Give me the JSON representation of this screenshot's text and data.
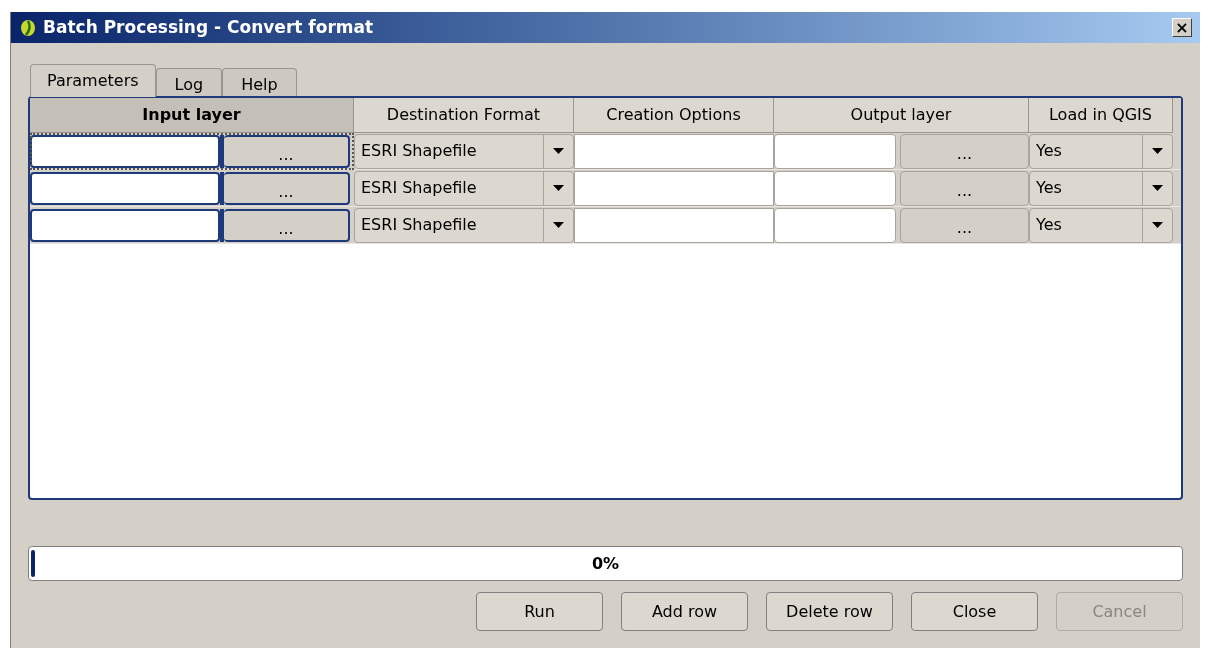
{
  "window": {
    "title": "Batch Processing - Convert format",
    "close_glyph": "×"
  },
  "tabs": [
    {
      "label": "Parameters",
      "selected": true
    },
    {
      "label": "Log",
      "selected": false
    },
    {
      "label": "Help",
      "selected": false
    }
  ],
  "table": {
    "columns": [
      "Input layer",
      "Destination Format",
      "Creation Options",
      "Output layer",
      "Load in QGIS"
    ],
    "rows": [
      {
        "current": true,
        "input_button": "...",
        "destination_format": "ESRI Shapefile",
        "output_button": "...",
        "load_in_qgis": "Yes"
      },
      {
        "current": false,
        "input_button": "...",
        "destination_format": "ESRI Shapefile",
        "output_button": "...",
        "load_in_qgis": "Yes"
      },
      {
        "current": false,
        "input_button": "...",
        "destination_format": "ESRI Shapefile",
        "output_button": "...",
        "load_in_qgis": "Yes"
      }
    ]
  },
  "progress": {
    "level": 0,
    "reading": "0%"
  },
  "buttons": [
    {
      "label": "Run",
      "disabled": false
    },
    {
      "label": "Add row",
      "disabled": false
    },
    {
      "label": "Delete row",
      "disabled": false
    },
    {
      "label": "Close",
      "disabled": false
    },
    {
      "label": "Cancel",
      "disabled": true
    }
  ]
}
